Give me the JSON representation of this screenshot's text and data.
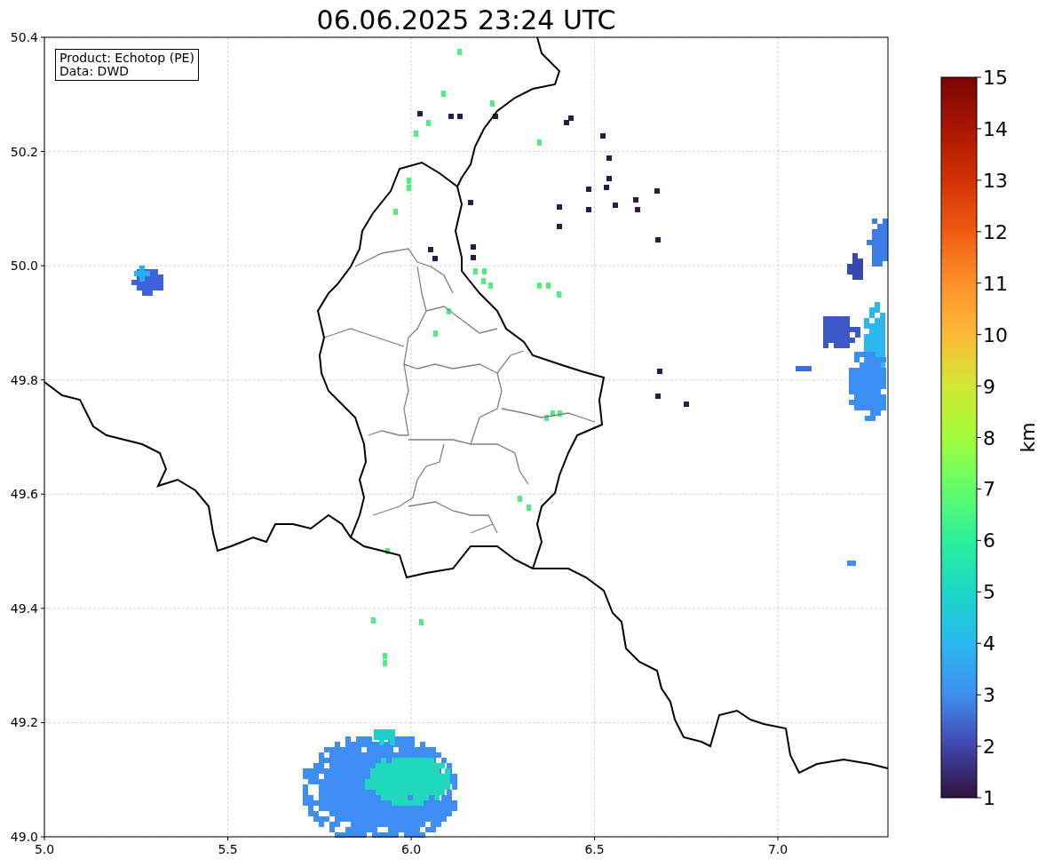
{
  "title": "06.06.2025 23:24 UTC",
  "info_box": {
    "lines": [
      "Product: Echotop (PE)",
      "Data: DWD"
    ]
  },
  "map": {
    "x_ticks": [
      "5.0",
      "5.5",
      "6.0",
      "6.5",
      "7.0"
    ],
    "y_ticks": [
      "50.4",
      "50.2",
      "50.0",
      "49.8",
      "49.6",
      "49.4",
      "49.2",
      "49.0"
    ]
  },
  "colorbar": {
    "label": "km",
    "ticks": [
      "15",
      "14",
      "13",
      "12",
      "11",
      "10",
      "9",
      "8",
      "7",
      "6",
      "5",
      "4",
      "3",
      "2",
      "1"
    ]
  }
}
